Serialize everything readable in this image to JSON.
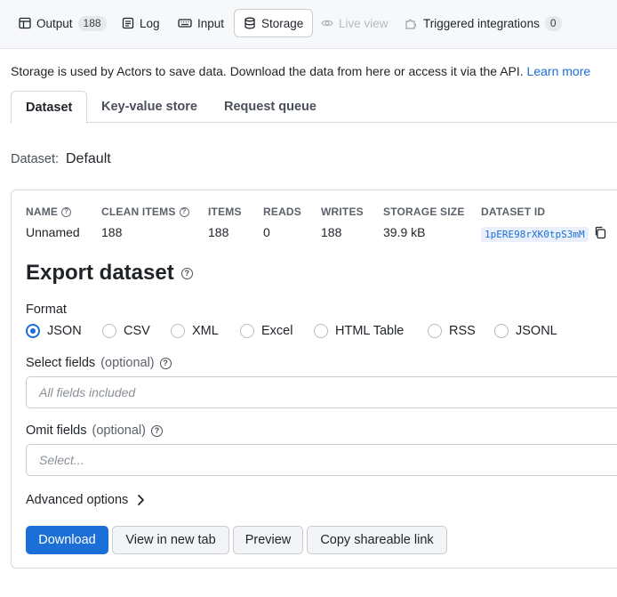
{
  "top_tabs": [
    {
      "label": "Output",
      "count": "188",
      "icon": "table-icon"
    },
    {
      "label": "Log",
      "icon": "log-icon"
    },
    {
      "label": "Input",
      "icon": "keyboard-icon"
    },
    {
      "label": "Storage",
      "icon": "database-icon",
      "active": true
    },
    {
      "label": "Live view",
      "icon": "eye-icon",
      "disabled": true
    },
    {
      "label": "Triggered integrations",
      "count": "0",
      "icon": "puzzle-icon"
    }
  ],
  "intro": {
    "text": "Storage is used by Actors to save data. Download the data from here or access it via the API.",
    "link": "Learn more"
  },
  "storage_tabs": [
    "Dataset",
    "Key-value store",
    "Request queue"
  ],
  "dataset": {
    "label": "Dataset:",
    "value": "Default"
  },
  "stats": {
    "headers": [
      "NAME",
      "CLEAN ITEMS",
      "ITEMS",
      "READS",
      "WRITES",
      "STORAGE SIZE",
      "DATASET ID"
    ],
    "values": [
      "Unnamed",
      "188",
      "188",
      "0",
      "188",
      "39.9 kB",
      "1pERE98rXK0tpS3mM"
    ]
  },
  "export": {
    "title": "Export dataset",
    "format_label": "Format",
    "formats": [
      "JSON",
      "CSV",
      "XML",
      "Excel",
      "HTML Table",
      "RSS",
      "JSONL"
    ],
    "selected_format": "JSON",
    "select_fields": {
      "label": "Select fields",
      "optional": "(optional)",
      "placeholder": "All fields included"
    },
    "omit_fields": {
      "label": "Omit fields",
      "optional": "(optional)",
      "placeholder": "Select..."
    },
    "advanced": "Advanced options"
  },
  "buttons": {
    "download": "Download",
    "view_new_tab": "View in new tab",
    "preview": "Preview",
    "copy_link": "Copy shareable link"
  },
  "colors": {
    "accent": "#1b6fd6",
    "disabled": "#b6bbc2"
  }
}
